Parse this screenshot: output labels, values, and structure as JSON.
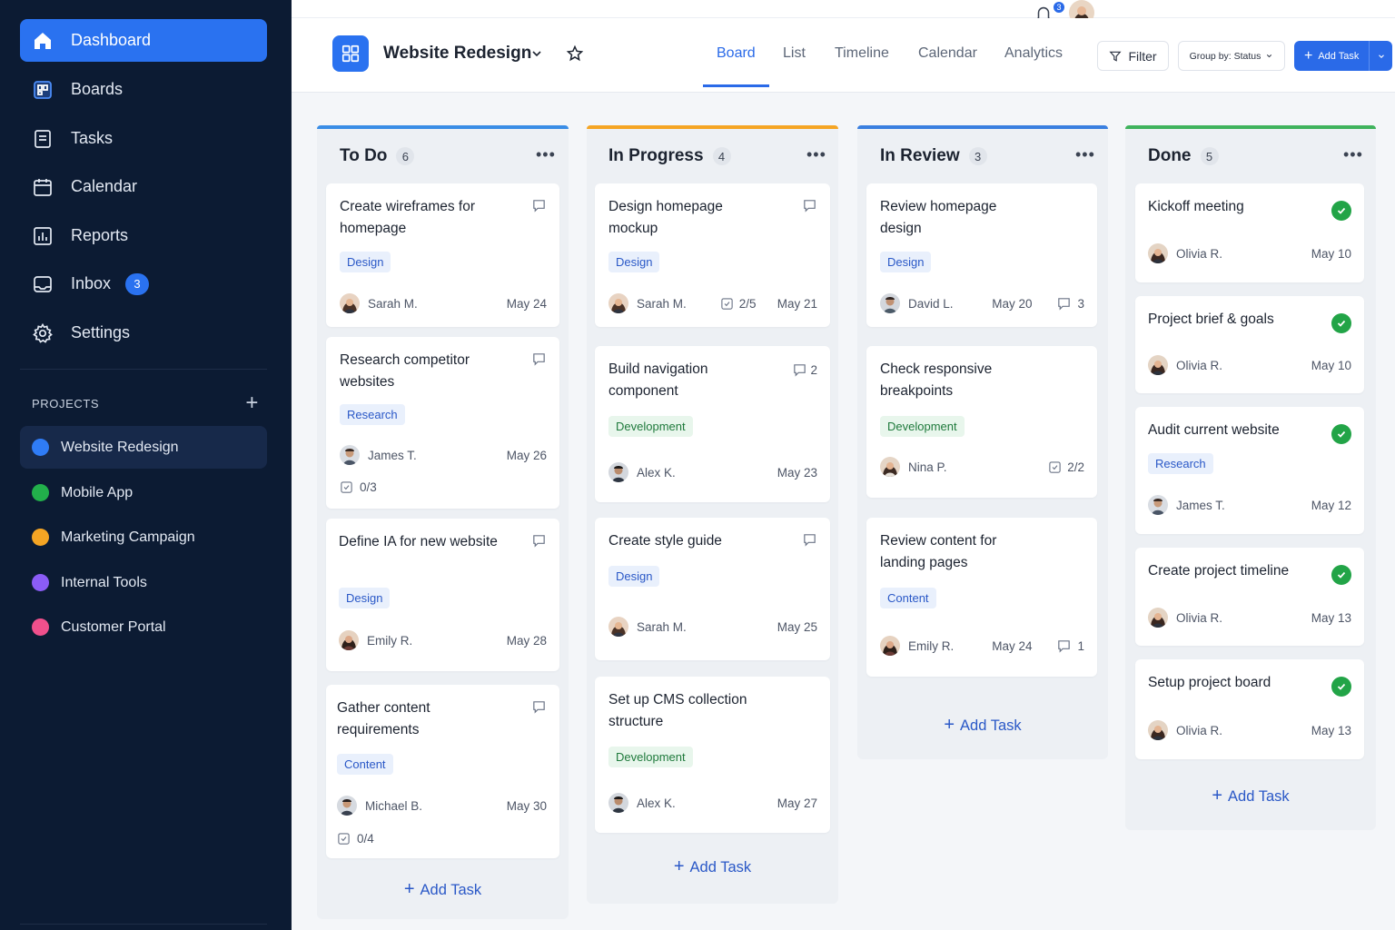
{
  "sidebar": {
    "nav": [
      {
        "label": "Dashboard",
        "icon": "home-icon"
      },
      {
        "label": "Boards",
        "icon": "boards-icon"
      },
      {
        "label": "Tasks",
        "icon": "tasks-icon"
      },
      {
        "label": "Calendar",
        "icon": "calendar-icon"
      },
      {
        "label": "Reports",
        "icon": "reports-icon"
      },
      {
        "label": "Inbox",
        "icon": "inbox-icon",
        "badge": "3"
      },
      {
        "label": "Settings",
        "icon": "gear-icon"
      }
    ],
    "projects_label": "PROJECTS",
    "projects_add": "+",
    "projects": [
      {
        "label": "Website Redesign",
        "color": "#2f7cf6"
      },
      {
        "label": "Mobile App",
        "color": "#22b04b"
      },
      {
        "label": "Marketing Campaign",
        "color": "#f5a524"
      },
      {
        "label": "Internal Tools",
        "color": "#8b5cf6"
      },
      {
        "label": "Customer Portal",
        "color": "#f0508c"
      }
    ]
  },
  "header": {
    "project_title": "Website Redesign",
    "tabs": [
      "Board",
      "List",
      "Timeline",
      "Calendar",
      "Analytics"
    ],
    "active_tab": "Board",
    "filter_label": "Filter",
    "group_label": "Group by: Status",
    "add_task_label": "Add Task",
    "notification_count": "3"
  },
  "colors": {
    "accent": "#2a6ae8",
    "todo": "#3a8de6",
    "progress": "#f5a524",
    "review": "#3a7fe0",
    "done": "#3fb35d"
  },
  "columns": [
    {
      "title": "To Do",
      "count": "6",
      "cards": [
        {
          "title": "Create wireframes for homepage",
          "tag": "Design",
          "assignee": "Sarah M.",
          "date": "May 24"
        },
        {
          "title": "Research competitor websites",
          "tag": "Research",
          "assignee": "James T.",
          "date": "May 26",
          "subtasks": "0/3"
        },
        {
          "title": "Define IA for new website",
          "tag": "Design",
          "assignee": "Emily R.",
          "date": "May 28"
        },
        {
          "title": "Gather content requirements",
          "tag": "Content",
          "assignee": "Michael B.",
          "date": "May 30",
          "subtasks": "0/4"
        }
      ],
      "add_label": "Add Task"
    },
    {
      "title": "In Progress",
      "count": "4",
      "cards": [
        {
          "title": "Design homepage mockup",
          "tag": "Design",
          "assignee": "Sarah M.",
          "checklist": "2/5",
          "date": "May 21"
        },
        {
          "title": "Build navigation component",
          "tag": "Development",
          "assignee": "Alex K.",
          "date": "May 23",
          "comments": "2"
        },
        {
          "title": "Create style guide",
          "tag": "Design",
          "assignee": "Sarah M.",
          "date": "May 25"
        },
        {
          "title": "Set up CMS collection structure",
          "tag": "Development",
          "assignee": "Alex K.",
          "date": "May 27"
        }
      ],
      "add_label": "Add Task"
    },
    {
      "title": "In Review",
      "count": "3",
      "cards": [
        {
          "title": "Review homepage design",
          "tag": "Design",
          "assignee": "David L.",
          "date": "May 20",
          "comments": "3"
        },
        {
          "title": "Check responsive breakpoints",
          "tag": "Development",
          "assignee": "Nina P.",
          "checklist": "2/2"
        },
        {
          "title": "Review content for landing pages",
          "tag": "Content",
          "assignee": "Emily R.",
          "date": "May 24",
          "comments": "1"
        }
      ],
      "add_label": "Add Task"
    },
    {
      "title": "Done",
      "count": "5",
      "cards": [
        {
          "title": "Kickoff meeting",
          "assignee": "Olivia R.",
          "date": "May 10"
        },
        {
          "title": "Project brief & goals",
          "assignee": "Olivia R.",
          "date": "May 10"
        },
        {
          "title": "Audit current website",
          "tag": "Research",
          "assignee": "James T.",
          "date": "May 12"
        },
        {
          "title": "Create project timeline",
          "assignee": "Olivia R.",
          "date": "May 13"
        },
        {
          "title": "Setup project board",
          "assignee": "Olivia R.",
          "date": "May 13"
        }
      ],
      "add_label": "Add Task"
    }
  ]
}
